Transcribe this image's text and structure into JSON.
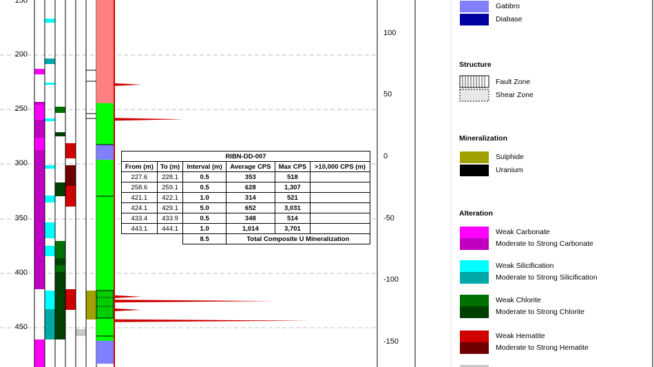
{
  "depth_axis": {
    "ticks": [
      150,
      200,
      250,
      300,
      350,
      400,
      450
    ]
  },
  "elevation_axis": {
    "ticks": [
      100,
      50,
      0,
      -50,
      -100,
      -150
    ]
  },
  "table": {
    "title": "RIBN-DD-007",
    "headers": [
      "From (m)",
      "To (m)",
      "Interval (m)",
      "Average CPS",
      "Max CPS",
      ">10,000 CPS (m)"
    ],
    "rows": [
      [
        "227.6",
        "228.1",
        "0.5",
        "353",
        "518",
        ""
      ],
      [
        "258.6",
        "259.1",
        "0.5",
        "628",
        "1,307",
        ""
      ],
      [
        "421.1",
        "422.1",
        "1.0",
        "314",
        "521",
        ""
      ],
      [
        "424.1",
        "429.1",
        "5.0",
        "652",
        "3,031",
        ""
      ],
      [
        "433.4",
        "433.9",
        "0.5",
        "348",
        "514",
        ""
      ],
      [
        "443.1",
        "444.1",
        "1.0",
        "1,014",
        "3,701",
        ""
      ]
    ],
    "total_interval": "8.5",
    "total_label": "Total Composite U Mineralization"
  },
  "legend": {
    "lithology_items": [
      {
        "label": "Gabbro",
        "color": "#8080ff"
      },
      {
        "label": "Diabase",
        "color": "#0000a0"
      }
    ],
    "structure_title": "Structure",
    "structure_items": [
      {
        "label": "Fault Zone",
        "pattern": "vertical-lines"
      },
      {
        "label": "Shear Zone",
        "pattern": "dots"
      }
    ],
    "mineralization_title": "Mineralization",
    "mineralization_items": [
      {
        "label": "Sulphide",
        "color": "#a0a000"
      },
      {
        "label": "Uranium",
        "color": "#000000"
      }
    ],
    "alteration_title": "Alteration",
    "alteration_items": [
      {
        "label": "Weak Carbonate",
        "color": "#ff00ff"
      },
      {
        "label": "Moderate to Strong Carbonate",
        "color": "#c000c0"
      },
      {
        "label": "Weak Silicification",
        "color": "#00ffff"
      },
      {
        "label": "Moderate to Strong Silicification",
        "color": "#00a8a8"
      },
      {
        "label": "Weak Chlorite",
        "color": "#007000"
      },
      {
        "label": "Moderate to Strong Chlorite",
        "color": "#004000"
      },
      {
        "label": "Weak Hematite",
        "color": "#d00000"
      },
      {
        "label": "Moderate to Strong Hematite",
        "color": "#700000"
      }
    ]
  },
  "chart_data": {
    "type": "table",
    "title": "RIBN-DD-007",
    "depth_axis": {
      "range": [
        137,
        483
      ],
      "ticks": [
        150,
        200,
        250,
        300,
        350,
        400,
        450
      ]
    },
    "elevation_axis": {
      "range": [
        125,
        -170
      ],
      "ticks": [
        100,
        50,
        0,
        -50,
        -100,
        -150
      ]
    },
    "lithology_column": [
      {
        "from": 137,
        "to": 244,
        "unit": "salmon",
        "color": "#ff8080"
      },
      {
        "from": 244,
        "to": 282,
        "unit": "green",
        "color": "#00ff00"
      },
      {
        "from": 282,
        "to": 296,
        "unit": "Gabbro",
        "color": "#8080ff"
      },
      {
        "from": 296,
        "to": 462,
        "unit": "green",
        "color": "#00ff00"
      },
      {
        "from": 462,
        "to": 483,
        "unit": "Gabbro",
        "color": "#8080ff"
      }
    ],
    "radiometric_peaks": [
      {
        "depth": 227,
        "cps": 518
      },
      {
        "depth": 258.8,
        "cps": 1307
      },
      {
        "depth": 421.5,
        "cps": 521
      },
      {
        "depth": 425.5,
        "cps": 3031
      },
      {
        "depth": 433.6,
        "cps": 514
      },
      {
        "depth": 443.5,
        "cps": 3701
      }
    ],
    "intervals": [
      {
        "from": 227.6,
        "to": 228.1,
        "interval": 0.5,
        "avg_cps": 353,
        "max_cps": 518
      },
      {
        "from": 258.6,
        "to": 259.1,
        "interval": 0.5,
        "avg_cps": 628,
        "max_cps": 1307
      },
      {
        "from": 421.1,
        "to": 422.1,
        "interval": 1.0,
        "avg_cps": 314,
        "max_cps": 521
      },
      {
        "from": 424.1,
        "to": 429.1,
        "interval": 5.0,
        "avg_cps": 652,
        "max_cps": 3031
      },
      {
        "from": 433.4,
        "to": 433.9,
        "interval": 0.5,
        "avg_cps": 348,
        "max_cps": 514
      },
      {
        "from": 443.1,
        "to": 444.1,
        "interval": 1.0,
        "avg_cps": 1014,
        "max_cps": 3701
      }
    ],
    "total_composite_interval": 8.5
  }
}
